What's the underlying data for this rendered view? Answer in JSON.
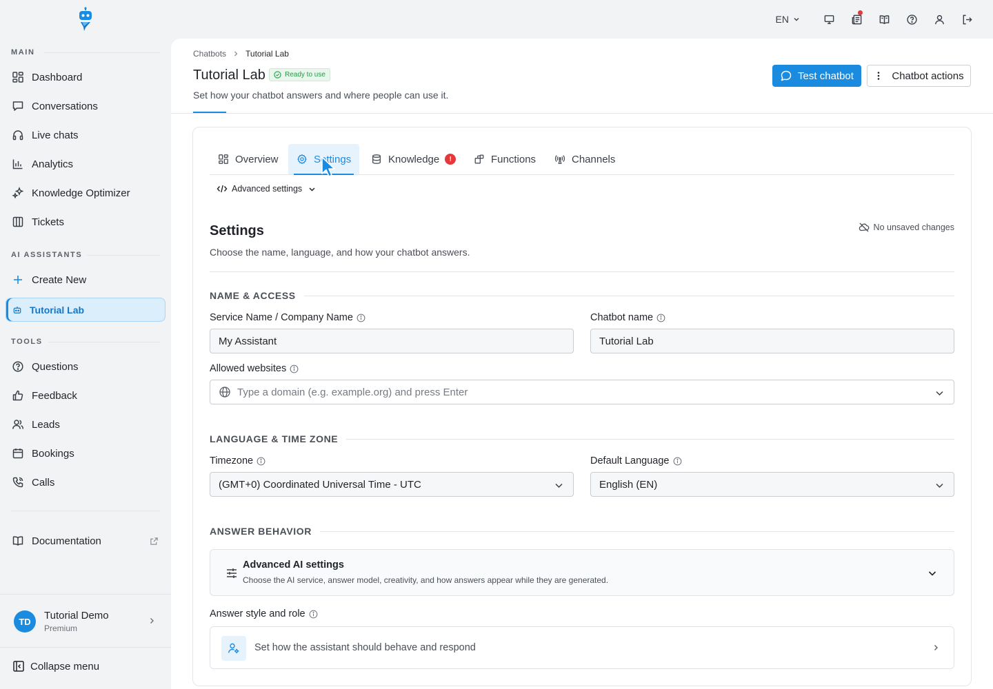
{
  "sidebar": {
    "sections": {
      "main": "MAIN",
      "ai_assistants": "AI ASSISTANTS",
      "tools": "TOOLS"
    },
    "main_items": [
      {
        "label": "Dashboard",
        "icon": "dashboard-icon"
      },
      {
        "label": "Conversations",
        "icon": "chat-icon"
      },
      {
        "label": "Live chats",
        "icon": "headset-icon"
      },
      {
        "label": "Analytics",
        "icon": "bar-chart-icon"
      },
      {
        "label": "Knowledge Optimizer",
        "icon": "sparkles-icon"
      },
      {
        "label": "Tickets",
        "icon": "columns-icon"
      }
    ],
    "ai_items": [
      {
        "label": "Create New",
        "icon": "plus-icon"
      },
      {
        "label": "Tutorial Lab",
        "icon": "bot-icon",
        "active": true
      }
    ],
    "tool_items": [
      {
        "label": "Questions",
        "icon": "question-icon"
      },
      {
        "label": "Feedback",
        "icon": "thumbs-up-icon"
      },
      {
        "label": "Leads",
        "icon": "users-icon"
      },
      {
        "label": "Bookings",
        "icon": "calendar-icon"
      },
      {
        "label": "Calls",
        "icon": "phone-icon"
      }
    ],
    "documentation": "Documentation",
    "user": {
      "initials": "TD",
      "name": "Tutorial Demo",
      "plan": "Premium"
    },
    "collapse": "Collapse menu"
  },
  "topbar": {
    "language": "EN",
    "icons": [
      "monitor-icon",
      "news-icon",
      "book-open-icon",
      "help-icon",
      "user-icon",
      "logout-icon"
    ]
  },
  "header": {
    "breadcrumb": [
      "Chatbots",
      "Tutorial Lab"
    ],
    "title": "Tutorial Lab",
    "badge": "Ready to use",
    "subtitle": "Set how your chatbot answers and where people can use it.",
    "test_button": "Test chatbot",
    "actions_button": "Chatbot actions"
  },
  "tabs": [
    {
      "label": "Overview",
      "icon": "dashboard-icon"
    },
    {
      "label": "Settings",
      "icon": "gear-icon",
      "active": true
    },
    {
      "label": "Knowledge",
      "icon": "database-icon",
      "badge": "!"
    },
    {
      "label": "Functions",
      "icon": "puzzle-icon"
    },
    {
      "label": "Channels",
      "icon": "broadcast-icon"
    }
  ],
  "advanced_toggle": "Advanced settings",
  "settings": {
    "title": "Settings",
    "description": "Choose the name, language, and how your chatbot answers.",
    "status": "No unsaved changes"
  },
  "name_access": {
    "heading": "NAME & ACCESS",
    "service_label": "Service Name / Company Name",
    "service_value": "My Assistant",
    "chatbot_label": "Chatbot name",
    "chatbot_value": "Tutorial Lab",
    "websites_label": "Allowed websites",
    "websites_placeholder": "Type a domain (e.g. example.org) and press Enter"
  },
  "language_time": {
    "heading": "LANGUAGE & TIME ZONE",
    "timezone_label": "Timezone",
    "timezone_value": "(GMT+0) Coordinated Universal Time - UTC",
    "language_label": "Default Language",
    "language_value": "English (EN)"
  },
  "answer_behavior": {
    "heading": "ANSWER BEHAVIOR",
    "advanced_title": "Advanced AI settings",
    "advanced_desc": "Choose the AI service, answer model, creativity, and how answers appear while they are generated.",
    "style_label": "Answer style and role",
    "style_prompt": "Set how the assistant should behave and respond"
  },
  "colors": {
    "accent": "#1b8be0",
    "success": "#2a9a4b",
    "danger": "#e5383b"
  }
}
